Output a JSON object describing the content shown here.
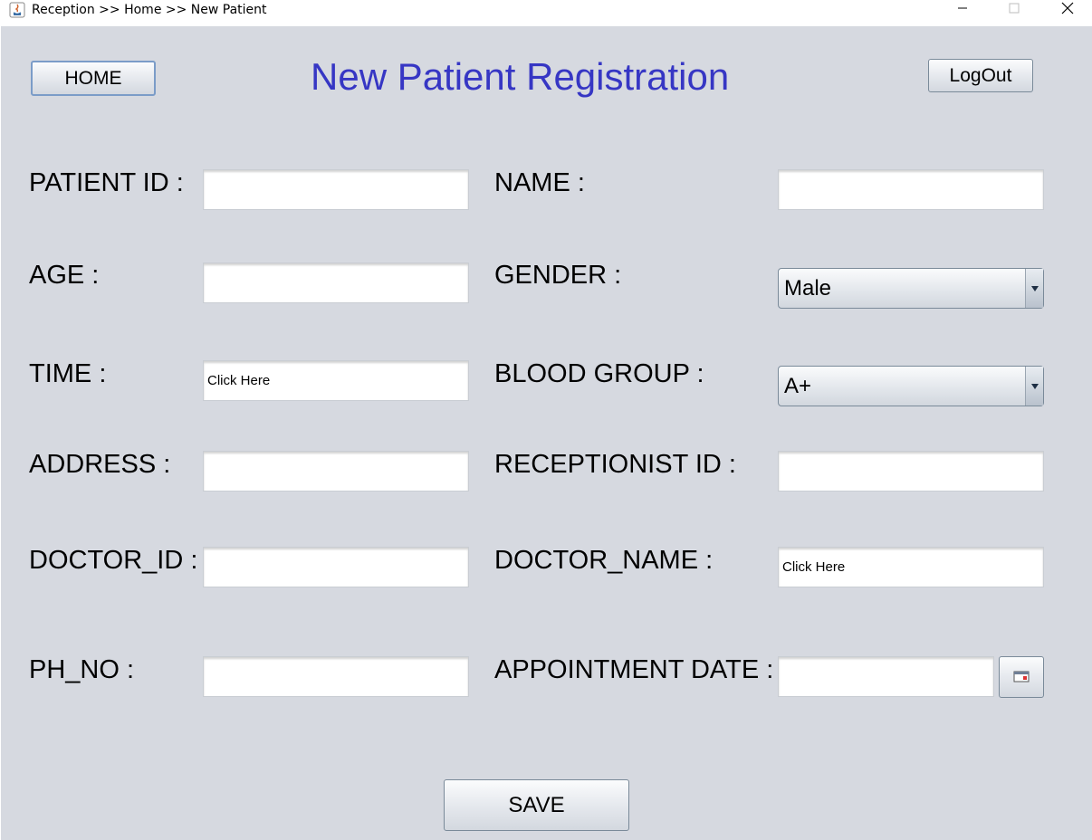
{
  "window": {
    "title": "Reception >> Home >> New Patient",
    "controls": {
      "minimize": "minimize-icon",
      "maximize": "maximize-icon",
      "close": "close-icon"
    }
  },
  "header": {
    "home_label": "HOME",
    "title": "New Patient Registration",
    "logout_label": "LogOut",
    "title_color": "#3636c4"
  },
  "form": {
    "patient_id": {
      "label": "PATIENT ID :",
      "value": ""
    },
    "name": {
      "label": "NAME :",
      "value": ""
    },
    "age": {
      "label": "AGE :",
      "value": ""
    },
    "gender": {
      "label": "GENDER :",
      "selected": "Male"
    },
    "time": {
      "label": "TIME :",
      "value": "Click Here"
    },
    "blood_group": {
      "label": "BLOOD GROUP :",
      "selected": "A+"
    },
    "address": {
      "label": "ADDRESS :",
      "value": ""
    },
    "receptionist_id": {
      "label": "RECEPTIONIST ID :",
      "value": ""
    },
    "doctor_id": {
      "label": "DOCTOR_ID :",
      "value": ""
    },
    "doctor_name": {
      "label": "DOCTOR_NAME :",
      "value": "Click Here"
    },
    "ph_no": {
      "label": "PH_NO :",
      "value": ""
    },
    "appointment_date": {
      "label": "APPOINTMENT DATE :",
      "value": "",
      "picker_icon": "calendar-icon"
    }
  },
  "actions": {
    "save_label": "SAVE"
  },
  "colors": {
    "background": "#d6d9e0",
    "field_bg": "#ffffff"
  }
}
